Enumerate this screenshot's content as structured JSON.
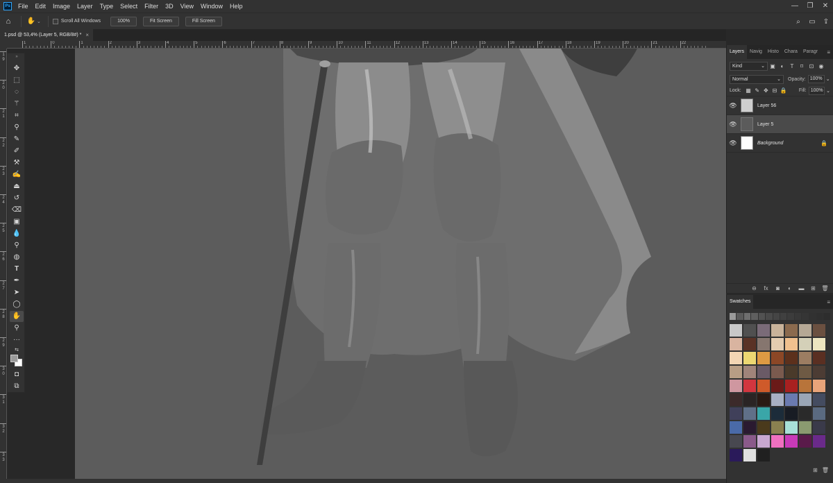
{
  "app": {
    "logo": "Ps"
  },
  "menu": [
    "File",
    "Edit",
    "Image",
    "Layer",
    "Type",
    "Select",
    "Filter",
    "3D",
    "View",
    "Window",
    "Help"
  ],
  "window_buttons": [
    "—",
    "❐",
    "✕"
  ],
  "options": {
    "scroll_all_windows": "Scroll All Windows",
    "zoom_100": "100%",
    "fit_screen": "Fit Screen",
    "fill_screen": "Fill Screen"
  },
  "document_tab": {
    "title": "1.psd @ 53,4% (Layer 5, RGB/8#) *",
    "close": "×"
  },
  "ruler": {
    "h_labels": [
      "1",
      "0",
      "1",
      "2",
      "3",
      "4",
      "5",
      "6",
      "7",
      "8",
      "9",
      "10",
      "11",
      "12",
      "13",
      "14",
      "15",
      "16",
      "17",
      "18",
      "19",
      "20",
      "21",
      "22"
    ],
    "v_labels": [
      "1 9",
      "2 0",
      "2 1",
      "2 2",
      "2 3",
      "2 4",
      "2 5",
      "2 6",
      "2 7",
      "2 8",
      "2 9",
      "3 0",
      "3 1",
      "3 2",
      "3 3"
    ]
  },
  "layers_panel": {
    "tabs": [
      "Layers",
      "Navig",
      "Histo",
      "Chara",
      "Paragr"
    ],
    "kind_label": "Kind",
    "blend_mode": "Normal",
    "opacity_label": "Opacity:",
    "opacity_value": "100%",
    "lock_label": "Lock:",
    "fill_label": "Fill:",
    "fill_value": "100%",
    "layers": [
      {
        "name": "Layer 56",
        "selected": false,
        "locked": false,
        "italic": false,
        "thumb": "#cfcfcf"
      },
      {
        "name": "Layer 5",
        "selected": true,
        "locked": false,
        "italic": false,
        "thumb": "#5b5b5b"
      },
      {
        "name": "Background",
        "selected": false,
        "locked": true,
        "italic": true,
        "thumb": "#ffffff"
      }
    ]
  },
  "swatches_panel": {
    "title": "Swatches",
    "recent": [
      "#9a9a9a",
      "#5b5b5b",
      "#6e6e6e",
      "#5f5f5f",
      "#525252",
      "#4a4a4a",
      "#454545",
      "#404040",
      "#3c3c3c",
      "#383838",
      "#353535",
      "#313131",
      "#2f2f2f",
      "#2d2d2d"
    ],
    "colors": [
      "#c8c8c8",
      "#505050",
      "#7a6b78",
      "#c9b39a",
      "#8b6a4e",
      "#b5a895",
      "#6b5040",
      "#d9b4a0",
      "#5a3226",
      "#86766f",
      "#e4ccb0",
      "#f0c08e",
      "#d4d0b8",
      "#eee6c0",
      "#f3d6b4",
      "#ecd772",
      "#de9a43",
      "#8c4726",
      "#5c301c",
      "#9c7d62",
      "#5a2f22",
      "#b89e85",
      "#a0847a",
      "#6a5a66",
      "#7a5a4e",
      "#4a3a2a",
      "#6e5a44",
      "#4c3c34",
      "#cf97a0",
      "#d2363f",
      "#cf5a2a",
      "#6a1a18",
      "#a82020",
      "#b8743a",
      "#e8a47a",
      "#3c2a2a",
      "#2a2424",
      "#2a1a14",
      "#a8b0c4",
      "#6a7ab0",
      "#9aa6b6",
      "#444c60",
      "#40405a",
      "#607088",
      "#3aa6a8",
      "#1c2c3a",
      "#181c24",
      "#2a2a2a",
      "#5a6a80",
      "#4a6aa8",
      "#2a1a30",
      "#4a3a1c",
      "#8a8050",
      "#a8e0d8",
      "#8a9a70",
      "#3a3a4a",
      "#484850",
      "#8a5a8a",
      "#c8a8d0",
      "#f070c0",
      "#c83ab8",
      "#5a1a4a",
      "#6a2a8a",
      "#2a1a5a",
      "#e0e0e0",
      "#202020"
    ]
  }
}
